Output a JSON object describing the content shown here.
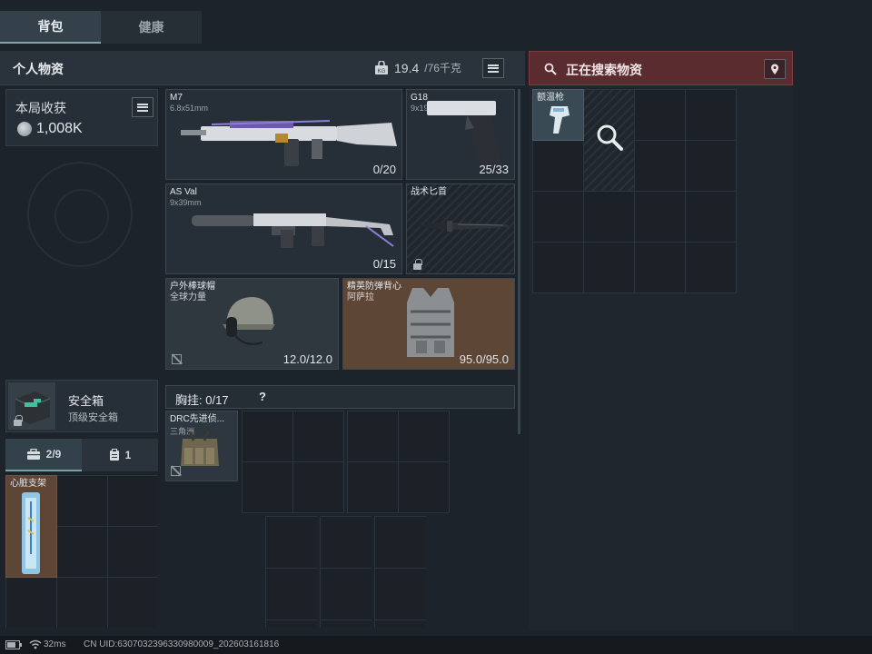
{
  "tabs": [
    {
      "label": "背包",
      "active": true
    },
    {
      "label": "健康",
      "active": false
    }
  ],
  "inventory": {
    "title": "个人物资",
    "weight_current": "19.4",
    "weight_max": "/76千克"
  },
  "harvest": {
    "label": "本局收获",
    "value": "1,008K"
  },
  "weapons": [
    {
      "name": "M7",
      "caliber": "6.8x51mm",
      "ammo": "0/20"
    },
    {
      "name": "G18",
      "caliber": "9x19mm",
      "ammo": "25/33"
    },
    {
      "name": "AS Val",
      "caliber": "9x39mm",
      "ammo": "0/15"
    },
    {
      "name": "战术匕首",
      "locked": true
    }
  ],
  "gear": [
    {
      "name": "户外棒球帽",
      "sub": "全球力量",
      "durability": "12.0/12.0"
    },
    {
      "name": "精英防弹背心",
      "sub": "阿萨拉",
      "durability": "95.0/95.0"
    }
  ],
  "safebox": {
    "title": "安全箱",
    "subtitle": "顶级安全箱",
    "tabs": [
      {
        "label": "2/9",
        "icon": "briefcase-icon",
        "active": true
      },
      {
        "label": "1",
        "icon": "clipboard-icon",
        "active": false
      }
    ],
    "item": "心脏支架"
  },
  "chest_rig": {
    "label": "胸挂: 0/17",
    "help": "?",
    "item_name": "DRC先进侦...",
    "item_sub": "三角洲"
  },
  "search_panel": {
    "title": "正在搜索物资",
    "item": "额温枪"
  },
  "status": {
    "ping": "32ms",
    "uid": "CN UID:6307032396330980009_202603161816"
  },
  "colors": {
    "background": "#1c232b",
    "search_header": "#5a2b2f",
    "accent": "#86a5a8",
    "vest_card": "#5e4636"
  }
}
